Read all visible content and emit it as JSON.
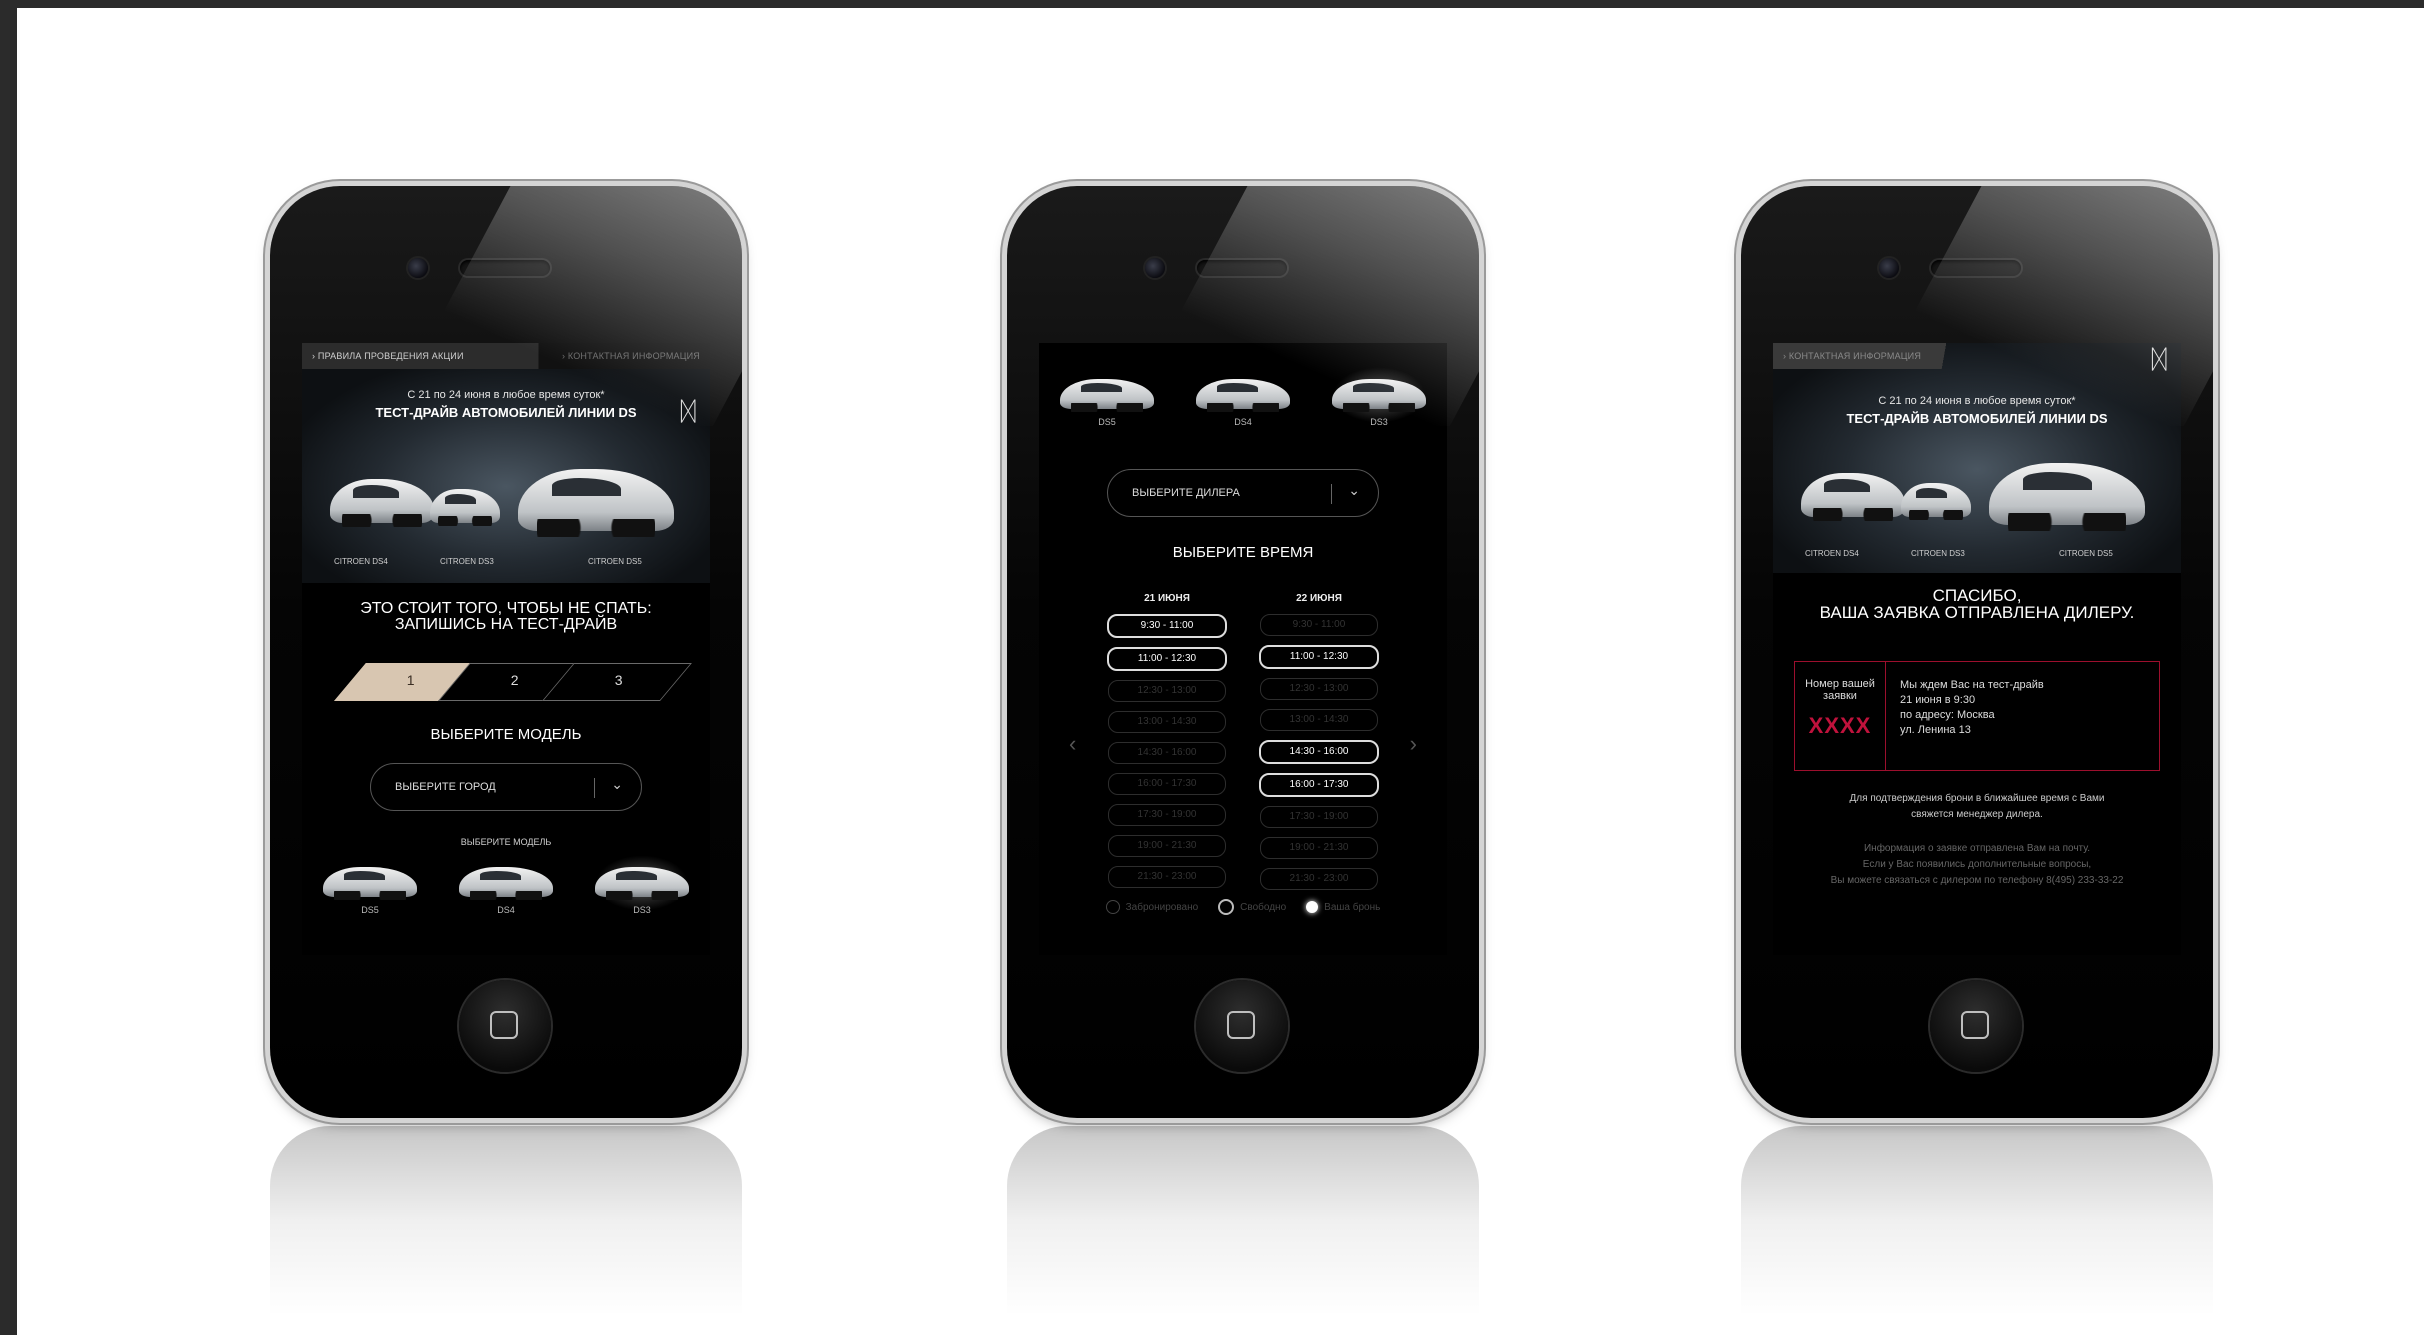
{
  "phone1": {
    "topbar": {
      "left": "› Правила проведения акции",
      "right": "› Контактная информация"
    },
    "hero": {
      "promo_line": "С 21 по 24 июня в любое время суток*",
      "promo_title": "ТЕСТ-ДРАЙВ АВТОМОБИЛЕЙ ЛИНИИ DS",
      "captions": [
        "CITROEN DS4",
        "CITROEN DS3",
        "CITROEN DS5"
      ]
    },
    "headline": "ЭТО СТОИТ ТОГО, ЧТОБЫ НЕ СПАТЬ:\nЗАПИШИСЬ НА ТЕСТ-ДРАЙВ",
    "steps": [
      "1",
      "2",
      "3"
    ],
    "section_title": "ВЫБЕРИТЕ МОДЕЛЬ",
    "city_select": "ВЫБЕРИТЕ ГОРОД",
    "model_label": "ВЫБЕРИТЕ МОДЕЛЬ",
    "models": [
      "DS5",
      "DS4",
      "DS3"
    ]
  },
  "phone2": {
    "models": [
      "DS5",
      "DS4",
      "DS3"
    ],
    "dealer_select": "ВЫБЕРИТЕ ДИЛЕРА",
    "time_title": "ВЫБЕРИТЕ ВРЕМЯ",
    "days": [
      {
        "label": "21 июня",
        "slots": [
          {
            "time": "9:30 - 11:00",
            "state": "free"
          },
          {
            "time": "11:00 - 12:30",
            "state": "free"
          },
          {
            "time": "12:30 - 13:00",
            "state": "booked"
          },
          {
            "time": "13:00 - 14:30",
            "state": "booked"
          },
          {
            "time": "14:30 - 16:00",
            "state": "booked"
          },
          {
            "time": "16:00 - 17:30",
            "state": "booked"
          },
          {
            "time": "17:30 - 19:00",
            "state": "booked"
          },
          {
            "time": "19:00 - 21:30",
            "state": "booked"
          },
          {
            "time": "21:30 - 23:00",
            "state": "booked"
          }
        ]
      },
      {
        "label": "22 июня",
        "slots": [
          {
            "time": "9:30 - 11:00",
            "state": "booked"
          },
          {
            "time": "11:00 - 12:30",
            "state": "free"
          },
          {
            "time": "12:30 - 13:00",
            "state": "booked"
          },
          {
            "time": "13:00 - 14:30",
            "state": "booked"
          },
          {
            "time": "14:30 - 16:00",
            "state": "free"
          },
          {
            "time": "16:00 - 17:30",
            "state": "free"
          },
          {
            "time": "17:30 - 19:00",
            "state": "booked"
          },
          {
            "time": "19:00 - 21:30",
            "state": "booked"
          },
          {
            "time": "21:30 - 23:00",
            "state": "booked"
          }
        ]
      }
    ],
    "legend": [
      "Забронировано",
      "Свободно",
      "Ваша бронь"
    ]
  },
  "phone3": {
    "topbar": {
      "left": "› Контактная информация"
    },
    "hero": {
      "promo_line": "С 21 по 24 июня в любое время суток*",
      "promo_title": "ТЕСТ-ДРАЙВ АВТОМОБИЛЕЙ ЛИНИИ DS",
      "captions": [
        "CITROEN DS4",
        "CITROEN DS3",
        "CITROEN DS5"
      ]
    },
    "thanks": "СПАСИБО,\nВАША ЗАЯВКА ОТПРАВЛЕНА ДИЛЕРУ.",
    "request_label": "Номер вашей заявки",
    "request_number": "XXXX",
    "details": "Мы ждем Вас на тест-драйв\n21 июня в 9:30\nпо адресу: Москва\nул. Ленина 13",
    "note": "Для подтверждения брони в ближайшее время с Вами\nсвяжется менеджер дилера.",
    "info": "Информация о заявке отправлена Вам на почту.\nЕсли у Вас появились дополнительные вопросы,\nВы можете связаться с дилером по телефону 8(495) 233-33-22"
  },
  "colors": {
    "accent": "#d8c6b1",
    "confirm_border": "#9c0f2d",
    "request_number": "#c0123c"
  }
}
